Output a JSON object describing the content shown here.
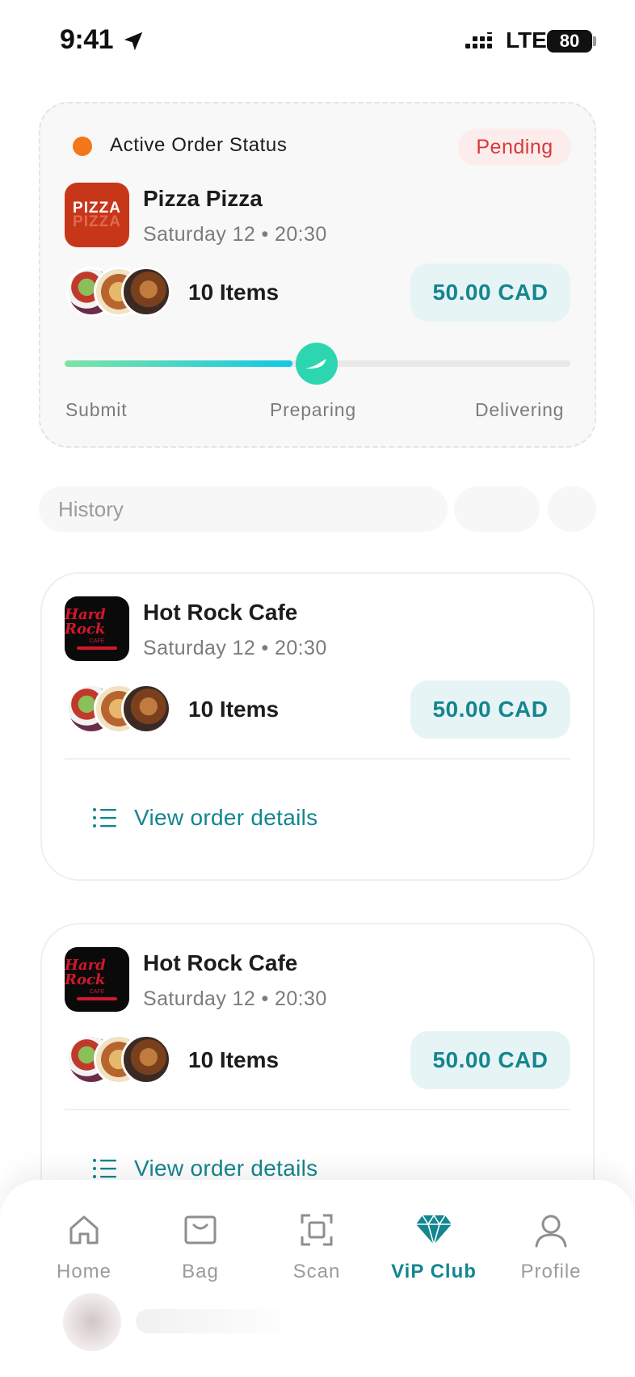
{
  "status_bar": {
    "time": "9:41",
    "network": "LTE",
    "battery": "80"
  },
  "active_order": {
    "title": "Active Order Status",
    "badge": "Pending",
    "restaurant": "Pizza Pizza",
    "logo_text_top": "PIZZA",
    "logo_text_bottom": "PIZZA",
    "date": "Saturday 12 • 20:30",
    "items": "10 Items",
    "price": "50.00 CAD",
    "progress": 0.45,
    "stages": [
      "Submit",
      "Preparing",
      "Delivering"
    ]
  },
  "history": {
    "tab_label": "History",
    "orders": [
      {
        "restaurant": "Hot Rock Cafe",
        "logo_text": "Hard Rock",
        "logo_sub": "CAFE",
        "date": "Saturday 12 • 20:30",
        "items": "10 Items",
        "price": "50.00 CAD",
        "link": "View order details"
      },
      {
        "restaurant": "Hot Rock Cafe",
        "logo_text": "Hard Rock",
        "logo_sub": "CAFE",
        "date": "Saturday 12 • 20:30",
        "items": "10 Items",
        "price": "50.00 CAD",
        "link": "View order details"
      }
    ]
  },
  "bottom_nav": {
    "items": [
      {
        "label": "Home",
        "icon": "home-icon"
      },
      {
        "label": "Bag",
        "icon": "bag-icon"
      },
      {
        "label": "Scan",
        "icon": "scan-icon"
      },
      {
        "label": "ViP Club",
        "icon": "diamond-icon"
      },
      {
        "label": "Profile",
        "icon": "profile-icon"
      }
    ],
    "active_index": 3
  },
  "colors": {
    "accent": "#13868f",
    "pending": "#d63a3a",
    "status_dot": "#f4761b",
    "price_bg": "#e7f4f5"
  }
}
